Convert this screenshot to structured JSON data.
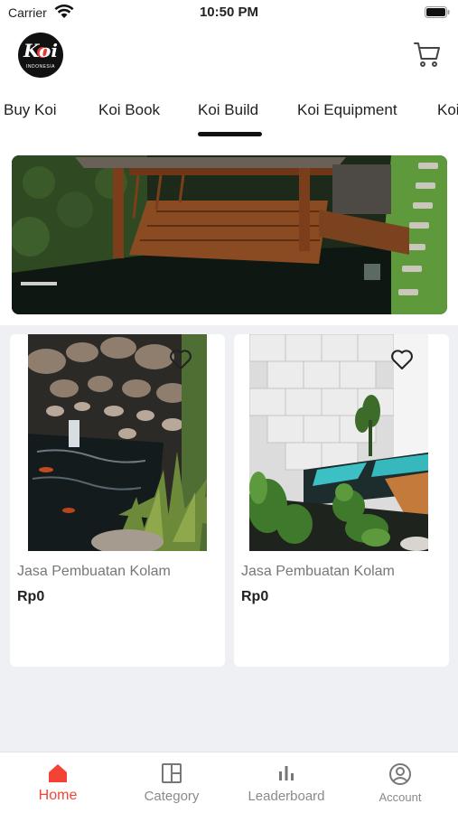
{
  "status_bar": {
    "carrier": "Carrier",
    "time": "10:50 PM"
  },
  "header": {
    "logo_text": "Koi",
    "logo_subtext": "INDONESIA",
    "cart_icon": "cart-icon"
  },
  "tabs": [
    {
      "label": "Buy Koi",
      "active": false
    },
    {
      "label": "Koi Book",
      "active": false
    },
    {
      "label": "Koi Build",
      "active": true
    },
    {
      "label": "Koi Equipment",
      "active": false
    },
    {
      "label": "Koi",
      "active": false
    }
  ],
  "products": [
    {
      "name": "Jasa Pembuatan Kolam",
      "price": "Rp0",
      "icon": "heart-outline-icon"
    },
    {
      "name": "Jasa Pembuatan Kolam",
      "price": "Rp0",
      "icon": "heart-outline-icon"
    }
  ],
  "bottom_nav": [
    {
      "label": "Home",
      "icon": "home-icon",
      "active": true
    },
    {
      "label": "Category",
      "icon": "category-icon",
      "active": false
    },
    {
      "label": "Leaderboard",
      "icon": "leaderboard-icon",
      "active": false
    },
    {
      "label": "Account",
      "icon": "account-icon",
      "active": false
    }
  ],
  "colors": {
    "accent": "#f44336",
    "background": "#eef0f4"
  }
}
